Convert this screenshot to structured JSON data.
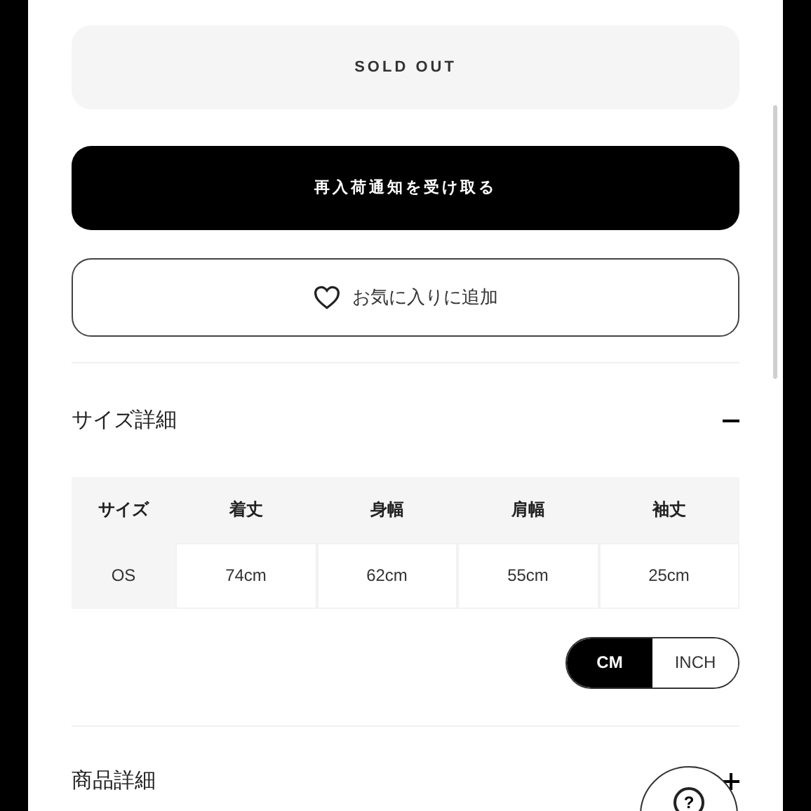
{
  "buttons": {
    "sold_out": "SOLD OUT",
    "notify": "再入荷通知を受け取る",
    "favorite": "お気に入りに追加"
  },
  "size_section": {
    "title": "サイズ詳細",
    "expanded": true,
    "table": {
      "columns": [
        "サイズ",
        "着丈",
        "身幅",
        "肩幅",
        "袖丈"
      ],
      "rows": [
        [
          "OS",
          "74cm",
          "62cm",
          "55cm",
          "25cm"
        ]
      ]
    },
    "units": [
      {
        "label": "CM",
        "selected": true
      },
      {
        "label": "INCH",
        "selected": false
      }
    ]
  },
  "product_section": {
    "title": "商品詳細",
    "expanded": false
  },
  "help_button": {
    "icon": "?"
  }
}
